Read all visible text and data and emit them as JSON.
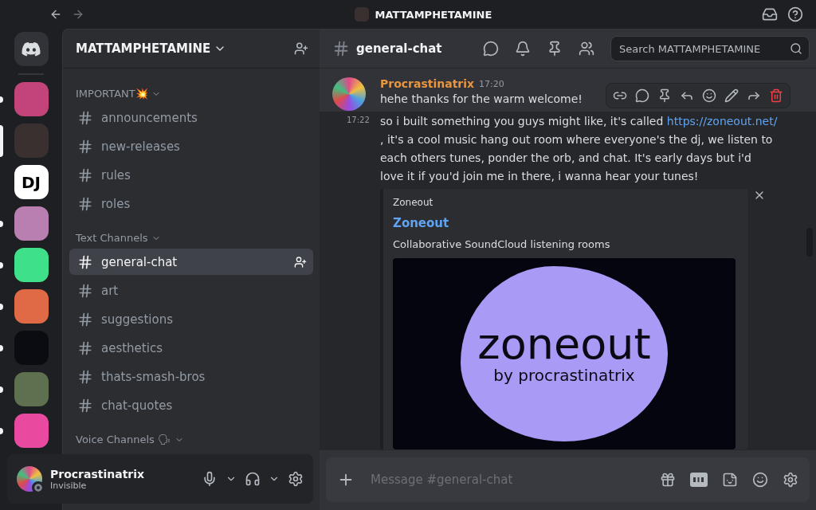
{
  "titlebar": {
    "server_name": "MATTAMPHETAMINE"
  },
  "servers": [
    {
      "kind": "image",
      "color": "#c2447a",
      "unread": true,
      "selected": false
    },
    {
      "kind": "image",
      "color": "#3a3030",
      "unread": false,
      "selected": true
    },
    {
      "kind": "text",
      "label": "DJ",
      "color": "#ffffff",
      "unread": false,
      "selected": false
    },
    {
      "kind": "image",
      "color": "#b97fb0",
      "unread": true,
      "selected": false
    },
    {
      "kind": "image",
      "color": "#3ee08a",
      "unread": true,
      "selected": false
    },
    {
      "kind": "image",
      "color": "#e06a45",
      "unread": true,
      "selected": false
    },
    {
      "kind": "image",
      "color": "#0b0b12",
      "unread": true,
      "selected": false
    },
    {
      "kind": "image",
      "color": "#5e7050",
      "unread": true,
      "selected": false
    },
    {
      "kind": "image",
      "color": "#e94aa0",
      "unread": true,
      "selected": false
    }
  ],
  "sidebar": {
    "server_name": "MATTAMPHETAMINE",
    "categories": [
      {
        "name": "IMPORTANT💥",
        "channels": [
          {
            "name": "announcements",
            "selected": false
          },
          {
            "name": "new-releases",
            "selected": false
          },
          {
            "name": "rules",
            "selected": false
          },
          {
            "name": "roles",
            "selected": false
          }
        ]
      },
      {
        "name": "Text Channels",
        "channels": [
          {
            "name": "general-chat",
            "selected": true
          },
          {
            "name": "art",
            "selected": false
          },
          {
            "name": "suggestions",
            "selected": false
          },
          {
            "name": "aesthetics",
            "selected": false
          },
          {
            "name": "thats-smash-bros",
            "selected": false
          },
          {
            "name": "chat-quotes",
            "selected": false
          }
        ]
      },
      {
        "name": "Voice Channels 🗣"
      }
    ]
  },
  "user_panel": {
    "name": "Procrastinatrix",
    "status": "Invisible"
  },
  "header": {
    "channel": "general-chat",
    "search": {
      "placeholder": "Search MATTAMPHETAMINE"
    }
  },
  "message": {
    "author": "Procrastinatrix",
    "time": "17:20",
    "lines": [
      {
        "text": "hehe thanks for the warm welcome!",
        "hovered": false
      },
      {
        "time": "17:22",
        "text": "so i built something you guys might like, it's called",
        "link": "https://zoneout.net/",
        "after": " , it's a cool music hang out room where everyone's the dj, we listen to each others tunes, ponder the orb, and chat. It's early days but i'd love it if you'd join me in there, i wanna hear your tunes!",
        "hovered": true
      }
    ],
    "embed": {
      "provider": "Zoneout",
      "title": "Zoneout",
      "description": "Collaborative SoundCloud listening rooms",
      "image_title": "zoneout",
      "image_subtitle": "by procrastinatrix"
    }
  },
  "composer": {
    "placeholder": "Message #general-chat"
  }
}
